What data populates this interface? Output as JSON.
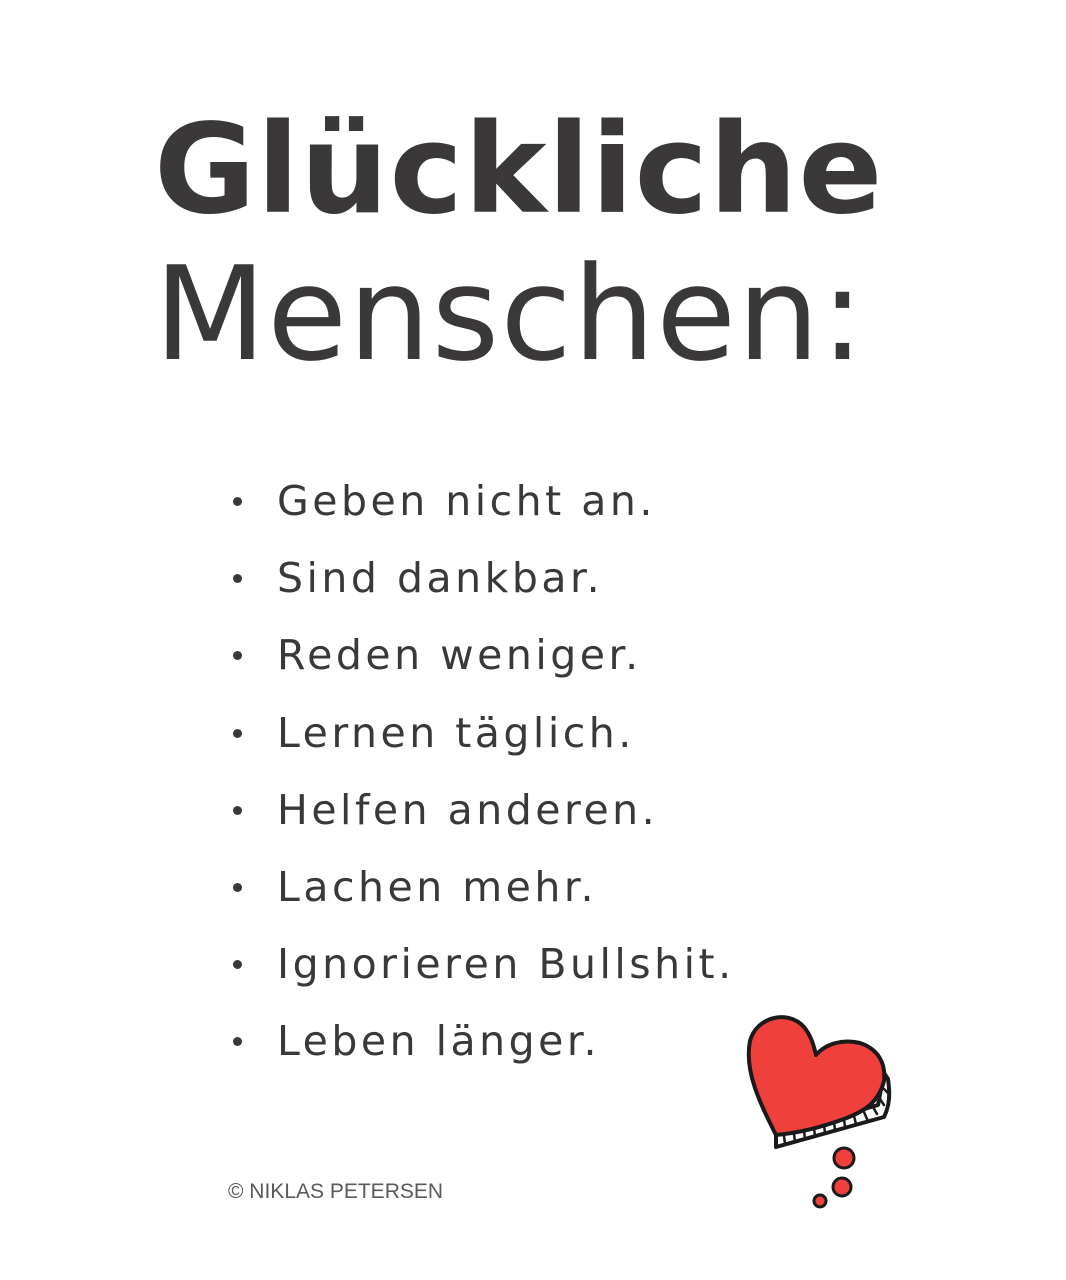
{
  "title": {
    "line1": "Glückliche",
    "line2": "Menschen:"
  },
  "list": {
    "items": [
      "Geben nicht an.",
      "Sind dankbar.",
      "Reden weniger.",
      "Lernen täglich.",
      "Helfen anderen.",
      "Lachen mehr.",
      "Ignorieren Bullshit.",
      "Leben länger."
    ]
  },
  "copyright": "© NIKLAS PETERSEN",
  "colors": {
    "text": "#3a3838",
    "heart": "#f0403c",
    "outline": "#1a1a1a"
  },
  "icons": {
    "heart": "heart-icon"
  }
}
